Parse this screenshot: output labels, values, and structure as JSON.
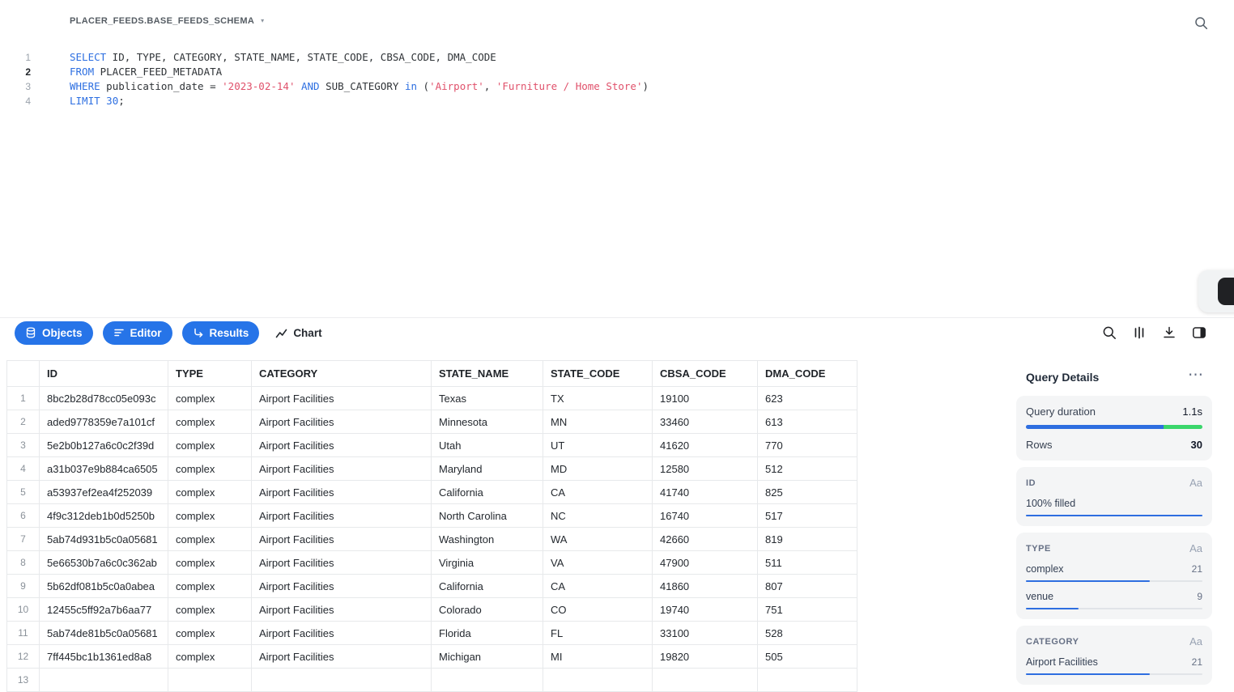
{
  "header": {
    "schema_selector": "PLACER_FEEDS.BASE_FEEDS_SCHEMA"
  },
  "editor": {
    "lines": [
      {
        "n": "1",
        "active": false,
        "tokens": [
          [
            "kw",
            "SELECT"
          ],
          [
            "pl",
            " ID, TYPE, CATEGORY, STATE_NAME, STATE_CODE, CBSA_CODE, DMA_CODE"
          ]
        ]
      },
      {
        "n": "2",
        "active": true,
        "tokens": [
          [
            "kw",
            "FROM"
          ],
          [
            "pl",
            " PLACER_FEED_METADATA"
          ]
        ]
      },
      {
        "n": "3",
        "active": false,
        "tokens": [
          [
            "kw",
            "WHERE"
          ],
          [
            "pl",
            " publication_date = "
          ],
          [
            "str",
            "'2023-02-14'"
          ],
          [
            "pl",
            " "
          ],
          [
            "kw",
            "AND"
          ],
          [
            "pl",
            " SUB_CATEGORY "
          ],
          [
            "kw",
            "in"
          ],
          [
            "pl",
            " ("
          ],
          [
            "str",
            "'Airport'"
          ],
          [
            "pl",
            ", "
          ],
          [
            "str",
            "'Furniture / Home Store'"
          ],
          [
            "pl",
            ")"
          ]
        ]
      },
      {
        "n": "4",
        "active": false,
        "tokens": [
          [
            "kw",
            "LIMIT"
          ],
          [
            "pl",
            " "
          ],
          [
            "num",
            "30"
          ],
          [
            "pl",
            ";"
          ]
        ]
      }
    ]
  },
  "toolbar": {
    "tabs": [
      {
        "label": "Objects"
      },
      {
        "label": "Editor"
      },
      {
        "label": "Results"
      },
      {
        "label": "Chart"
      }
    ],
    "icons": [
      "search-icon",
      "columns-icon",
      "download-icon",
      "panel-toggle-icon"
    ]
  },
  "table": {
    "columns": [
      "",
      "ID",
      "TYPE",
      "CATEGORY",
      "STATE_NAME",
      "STATE_CODE",
      "CBSA_CODE",
      "DMA_CODE"
    ],
    "rows": [
      [
        "1",
        "8bc2b28d78cc05e093c",
        "complex",
        "Airport Facilities",
        "Texas",
        "TX",
        "19100",
        "623"
      ],
      [
        "2",
        "aded9778359e7a101cf",
        "complex",
        "Airport Facilities",
        "Minnesota",
        "MN",
        "33460",
        "613"
      ],
      [
        "3",
        "5e2b0b127a6c0c2f39d",
        "complex",
        "Airport Facilities",
        "Utah",
        "UT",
        "41620",
        "770"
      ],
      [
        "4",
        "a31b037e9b884ca6505",
        "complex",
        "Airport Facilities",
        "Maryland",
        "MD",
        "12580",
        "512"
      ],
      [
        "5",
        "a53937ef2ea4f252039",
        "complex",
        "Airport Facilities",
        "California",
        "CA",
        "41740",
        "825"
      ],
      [
        "6",
        "4f9c312deb1b0d5250b",
        "complex",
        "Airport Facilities",
        "North Carolina",
        "NC",
        "16740",
        "517"
      ],
      [
        "7",
        "5ab74d931b5c0a05681",
        "complex",
        "Airport Facilities",
        "Washington",
        "WA",
        "42660",
        "819"
      ],
      [
        "8",
        "5e66530b7a6c0c362ab",
        "complex",
        "Airport Facilities",
        "Virginia",
        "VA",
        "47900",
        "511"
      ],
      [
        "9",
        "5b62df081b5c0a0abea",
        "complex",
        "Airport Facilities",
        "California",
        "CA",
        "41860",
        "807"
      ],
      [
        "10",
        "12455c5ff92a7b6aa77",
        "complex",
        "Airport Facilities",
        "Colorado",
        "CO",
        "19740",
        "751"
      ],
      [
        "11",
        "5ab74de81b5c0a05681",
        "complex",
        "Airport Facilities",
        "Florida",
        "FL",
        "33100",
        "528"
      ],
      [
        "12",
        "7ff445bc1b1361ed8a8",
        "complex",
        "Airport Facilities",
        "Michigan",
        "MI",
        "19820",
        "505"
      ],
      [
        "13",
        "",
        "",
        "",
        "",
        "",
        "",
        ""
      ]
    ]
  },
  "query_details": {
    "title": "Query Details",
    "more_icon": "ellipsis",
    "stats": [
      {
        "label": "Query duration",
        "value": "1.1s"
      },
      {
        "label": "Rows",
        "value": "30"
      }
    ],
    "duration_bar": {
      "blue_pct": 78,
      "green_pct": 22,
      "blue_color": "#2e6ee0",
      "green_color": "#3ad66b"
    },
    "fields": [
      {
        "name": "ID",
        "type_icon": "Aa",
        "items": [
          {
            "label": "100% filled",
            "count": "",
            "fill_pct": 100
          }
        ]
      },
      {
        "name": "TYPE",
        "type_icon": "Aa",
        "items": [
          {
            "label": "complex",
            "count": "21",
            "fill_pct": 70
          },
          {
            "label": "venue",
            "count": "9",
            "fill_pct": 30
          }
        ]
      },
      {
        "name": "CATEGORY",
        "type_icon": "Aa",
        "items": [
          {
            "label": "Airport Facilities",
            "count": "21",
            "fill_pct": 70
          }
        ]
      }
    ],
    "accent_color": "#2e6ee0"
  }
}
